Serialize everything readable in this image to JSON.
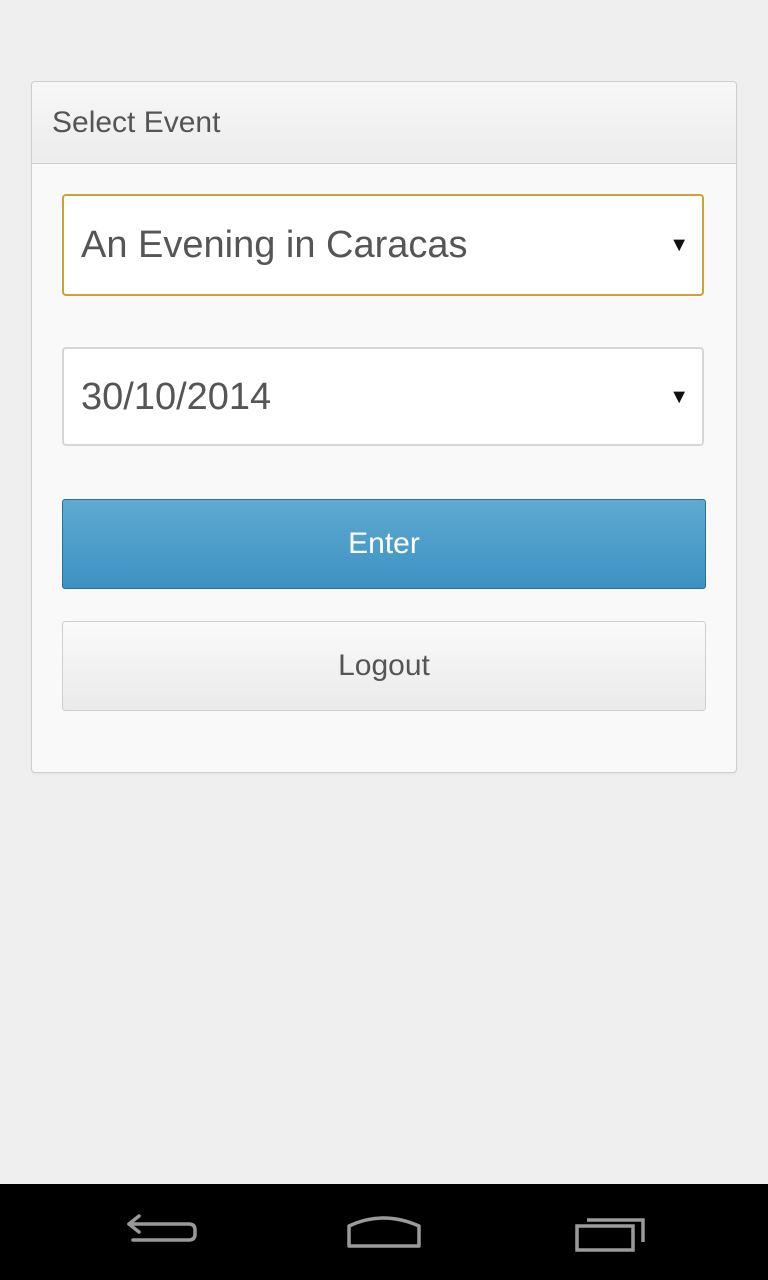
{
  "panel": {
    "title": "Select Event"
  },
  "event_select": {
    "value": "An Evening in Caracas",
    "caret": "▼"
  },
  "date_select": {
    "value": "30/10/2014",
    "caret": "▼"
  },
  "buttons": {
    "enter_label": "Enter",
    "logout_label": "Logout"
  },
  "navbar": {
    "icons": [
      "back-icon",
      "home-icon",
      "recent-apps-icon"
    ]
  },
  "colors": {
    "accent_blue": "#4a9cc8",
    "focus_border": "#c9a33a",
    "background": "#efefef"
  }
}
